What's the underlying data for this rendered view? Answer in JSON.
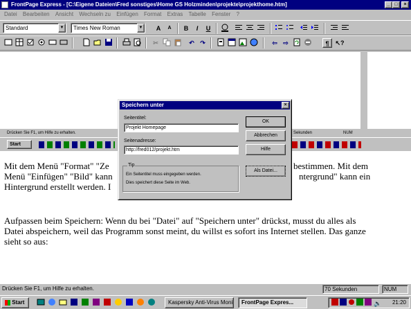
{
  "window": {
    "title": "FrontPage Express - [C:\\Eigene Dateien\\Fred sonstiges\\Home GS Holzminden\\projekte\\projekthome.htm]",
    "min": "_",
    "max": "□",
    "close": "×"
  },
  "menu": [
    "Datei",
    "Bearbeiten",
    "Ansicht",
    "Wechseln zu",
    "Einfügen",
    "Format",
    "Extras",
    "Tabelle",
    "Fenster",
    "?"
  ],
  "format_toolbar": {
    "style_value": "Standard",
    "font_value": "Times New Roman",
    "bold": "B",
    "italic": "I",
    "underline": "U",
    "font_up": "A",
    "font_down": "A"
  },
  "ghost": {
    "status_text": "Drücken Sie F1, um Hilfe zu erhalten.",
    "seconds": "Sekunden",
    "num": "NUM",
    "start": "Start"
  },
  "document": {
    "paragraph1": [
      "Mit dem Menü \"Format\" \"Ze",
      "Menü \"Einfügen\" \"Bild\" kann",
      "Hintergrund erstellt werden. I"
    ],
    "paragraph1_right": [
      "bestimmen. Mit dem",
      "ntergrund\" kann ein"
    ],
    "paragraph2": [
      "Aufpassen beim Speichern: Wenn du bei \"Datei\" auf \"Speichern unter\" drückst, musst du alles als",
      "Datei abspeichern, weil das Programm sonst meint, du willst es sofort ins Internet stellen. Das ganze",
      "sieht so aus:"
    ]
  },
  "dialog": {
    "title": "Speichern unter",
    "page_title_label": "Seitentitel:",
    "page_title_value": "Projekt Homepage",
    "page_address_label": "Seitenadresse:",
    "page_address_value": "http://fred012/projekt.htm",
    "ok": "OK",
    "cancel": "Abbrechen",
    "help": "Hilfe",
    "as_file": "Als Datei...",
    "tip_label": "Tip",
    "tip_line1": "Ein Seitentitel muss eingegeben werden.",
    "tip_line2": "Dies speichert diese Seite im Web."
  },
  "statusbar": {
    "text": "Drücken Sie F1, um Hilfe zu erhalten.",
    "time": "70 Sekunden",
    "num": "NUM"
  },
  "taskbar": {
    "start": "Start",
    "tasks": [
      "Kaspersky Anti-Virus Moni...",
      "FrontPage Expres..."
    ],
    "clock": "21:20"
  }
}
